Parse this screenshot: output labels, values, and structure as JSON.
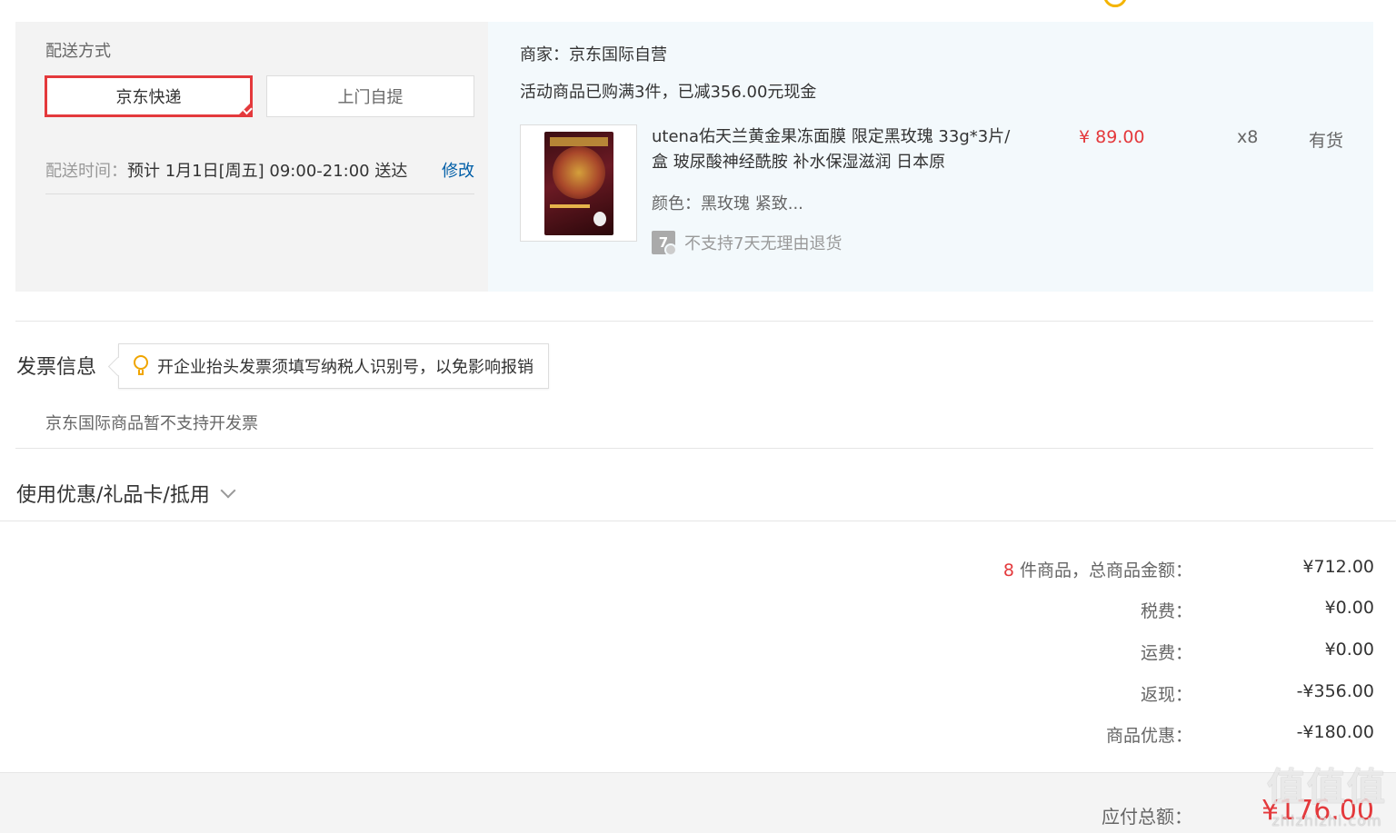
{
  "shipping": {
    "section_label": "配送方式",
    "options": [
      {
        "label": "京东快递",
        "selected": true
      },
      {
        "label": "上门自提",
        "selected": false
      }
    ],
    "time_label": "配送时间：",
    "time_value": "预计 1月1日[周五] 09:00-21:00 送达",
    "edit_link": "修改"
  },
  "order_item_group": {
    "merchant": "商家：京东国际自营",
    "promo": "活动商品已购满3件，已减356.00元现金",
    "product": {
      "name": "utena佑天兰黄金果冻面膜 限定黑玫瑰 33g*3片/盒 玻尿酸神经酰胺 补水保湿滋润 日本原",
      "color": "颜色：黑玫瑰 紧致...",
      "no_return_icon": "7",
      "no_return_text": "不支持7天无理由退货",
      "price": "¥ 89.00",
      "quantity": "x8",
      "stock": "有货"
    }
  },
  "invoice": {
    "title": "发票信息",
    "tip": "开企业抬头发票须填写纳税人识别号，以免影响报销",
    "note": "京东国际商品暂不支持开发票"
  },
  "coupon": {
    "title": "使用优惠/礼品卡/抵用"
  },
  "summary": {
    "count": "8",
    "count_label": " 件商品，总商品金额：",
    "total": "¥712.00",
    "tax_label": "税费：",
    "tax": "¥0.00",
    "freight_label": "运费：",
    "freight": "¥0.00",
    "cashback_label": "返现：",
    "cashback": "-¥356.00",
    "discount_label": "商品优惠：",
    "discount": "-¥180.00",
    "payable_label": "应付总额：",
    "payable": "¥176.00"
  },
  "watermark": {
    "big": "值值值",
    "small": "zhizhizhi.com"
  },
  "colors": {
    "accent": "#e4393c",
    "link": "#005ea7",
    "panel": "#f3f3f3",
    "panel_right": "#f3f9fc"
  }
}
